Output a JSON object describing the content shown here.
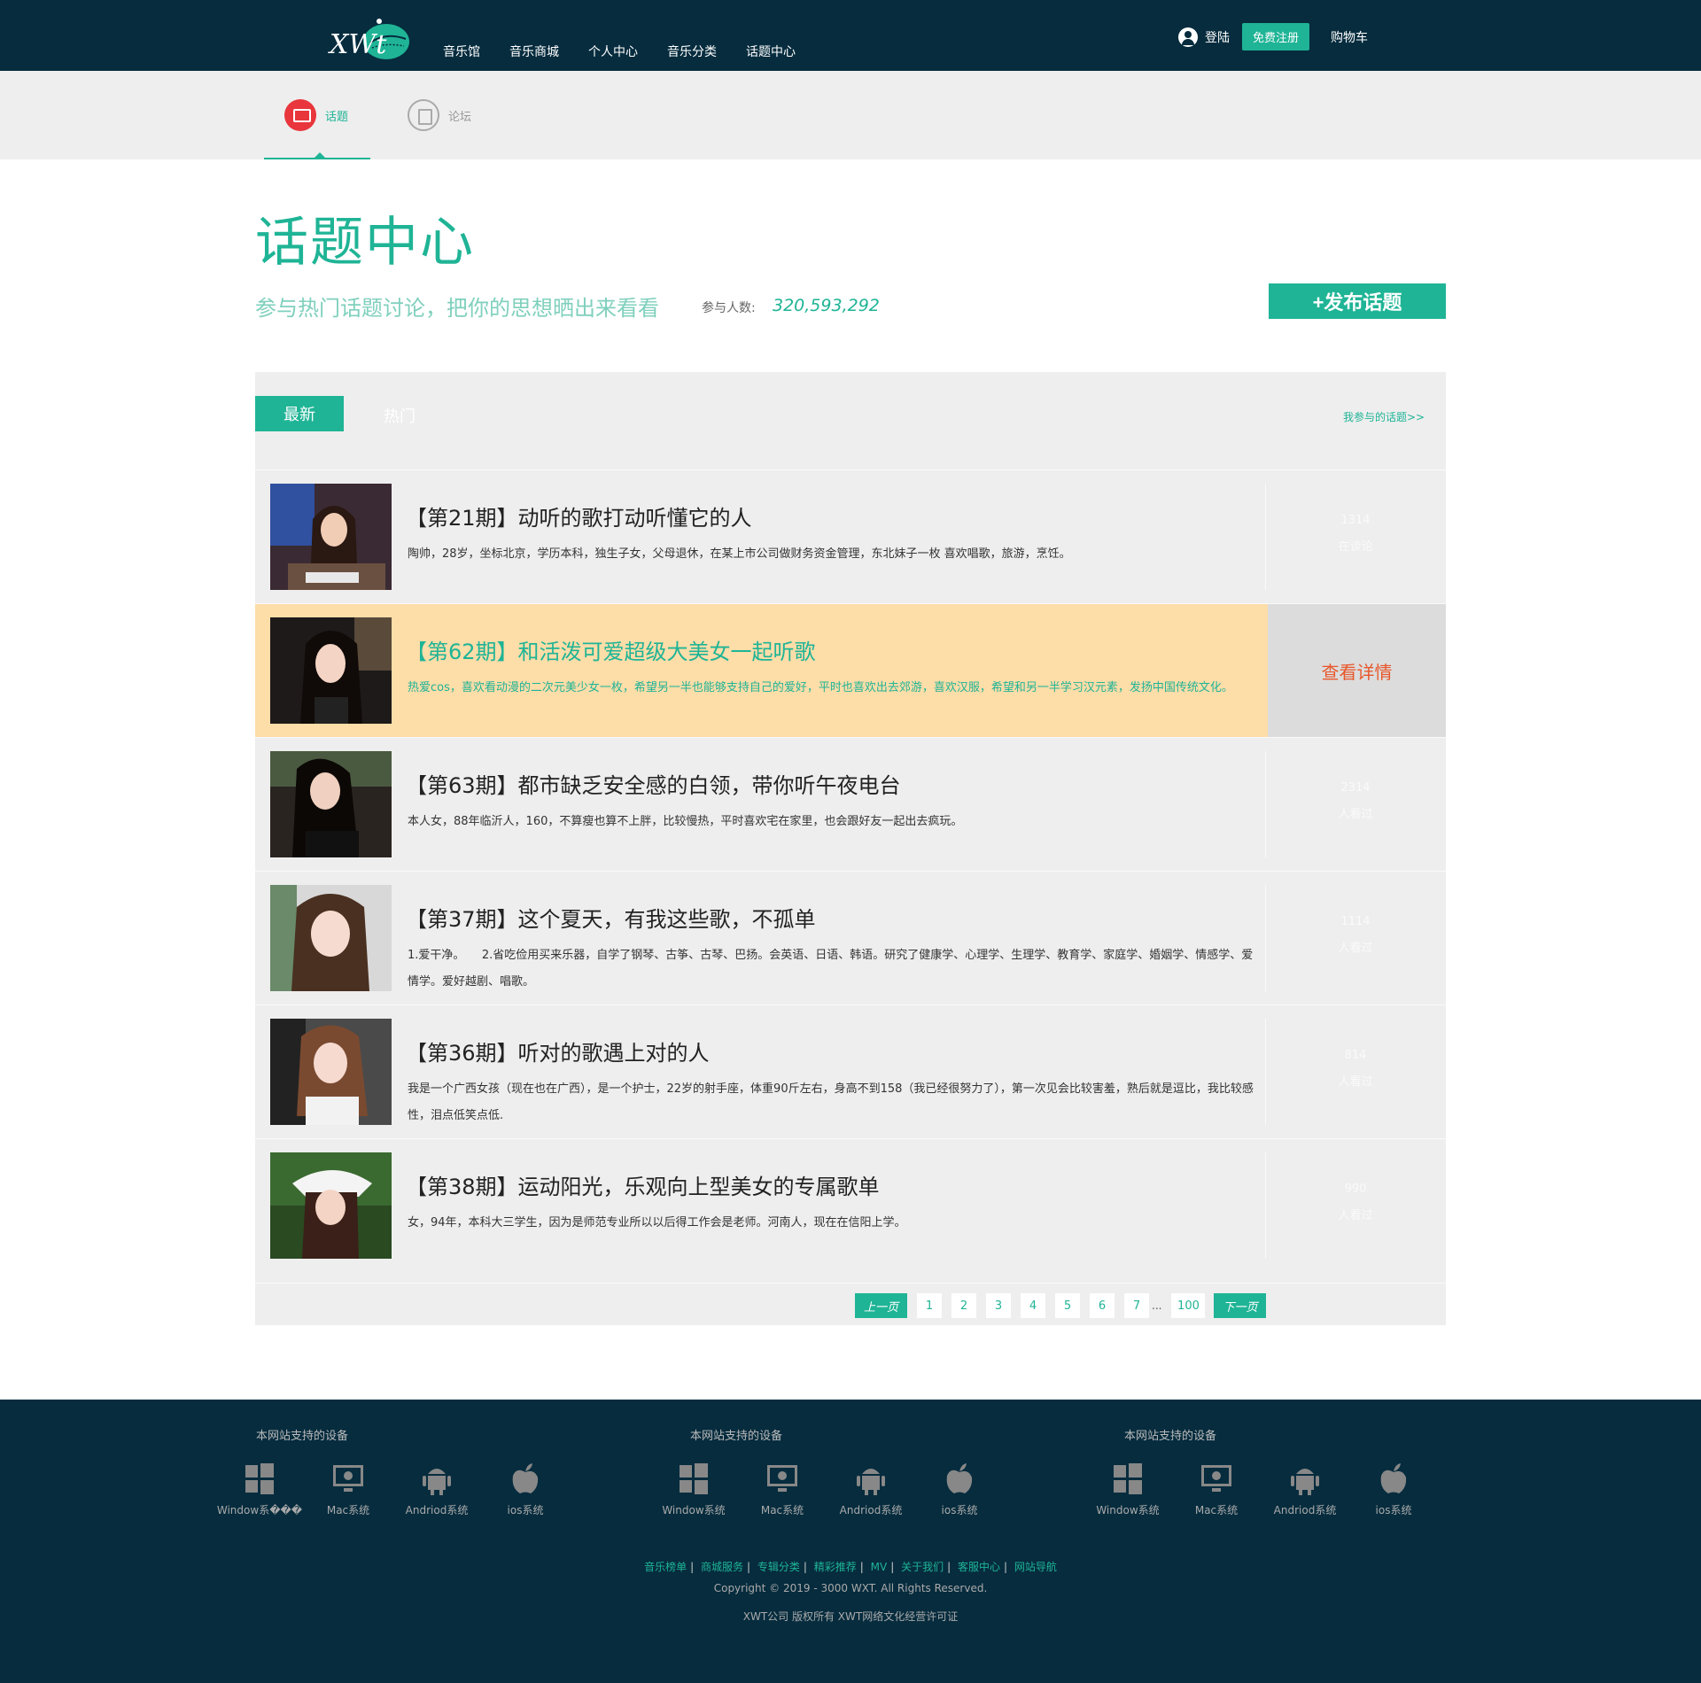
{
  "header": {
    "nav": [
      "音乐馆",
      "音乐商城",
      "个人中心",
      "音乐分类",
      "话题中心"
    ],
    "login": "登陆",
    "register": "免费注册",
    "cart": "购物车"
  },
  "subnav": {
    "topic": "话题",
    "forum": "论坛"
  },
  "hero": {
    "title": "话题中心",
    "slogan": "参与热门话题讨论，把你的思想晒出来看看",
    "participants_label": "参与人数:",
    "participants_count": "320,593,292",
    "publish": "+发布话题"
  },
  "tabs": {
    "latest": "最新",
    "hot": "热门",
    "my_topics": "我参与的话题>>"
  },
  "topics": [
    {
      "title": "【第21期】动听的歌打动听懂它的人",
      "desc": "陶帅，28岁，坐标北京，学历本科，独生子女，父母退休，在某上市公司做财务资金管理，东北妹子一枚 喜欢唱歌，旅游，烹饪。",
      "count": "1314",
      "count_label": "在谈论"
    },
    {
      "title": "【第62期】和活泼可爱超级大美女一起听歌",
      "desc": "热爱cos，喜欢看动漫的二次元美少女一枚，希望另一半也能够支持自己的爱好，平时也喜欢出去郊游，喜欢汉服，希望和另一半学习汉元素，发扬中国传统文化。",
      "detail": "查看详情"
    },
    {
      "title": "【第63期】都市缺乏安全感的白领，带你听午夜电台",
      "desc": "本人女，88年临沂人，160，不算瘦也算不上胖，比较慢热，平时喜欢宅在家里，也会跟好友一起出去疯玩。",
      "count": "2314",
      "count_label": "人看过"
    },
    {
      "title": "【第37期】这个夏天，有我这些歌，不孤单",
      "desc": "1.爱干净。　　2.省吃俭用买来乐器，自学了钢琴、古筝、古琴、巴扬。会英语、日语、韩语。研究了健康学、心理学、生理学、教育学、家庭学、婚姻学、情感学、爱情学。爱好越剧、唱歌。",
      "count": "1114",
      "count_label": "人看过"
    },
    {
      "title": "【第36期】听对的歌遇上对的人",
      "desc": "我是一个广西女孩（现在也在广西），是一个护士，22岁的射手座，体重90斤左右，身高不到158（我已经很努力了），第一次见会比较害羞，熟后就是逗比，我比较感性，泪点低笑点低.",
      "count": "814",
      "count_label": "人看过"
    },
    {
      "title": "【第38期】运动阳光，乐观向上型美女的专属歌单",
      "desc": "女，94年，本科大三学生，因为是师范专业所以以后得工作会是老师。河南人，现在在信阳上学。",
      "count": "990",
      "count_label": "人看过"
    }
  ],
  "pager": {
    "prev": "上一页",
    "pages": [
      "1",
      "2",
      "3",
      "4",
      "5",
      "6",
      "7"
    ],
    "dots": "...",
    "last": "100",
    "next": "下一页"
  },
  "footer": {
    "device_title": "本网站支持的设备",
    "groups": [
      [
        "Window系���",
        "Mac系统",
        "Andriod系统",
        "ios系统"
      ],
      [
        "Window系统",
        "Mac系统",
        "Andriod系统",
        "ios系统"
      ],
      [
        "Window系统",
        "Mac系统",
        "Andriod系统",
        "ios系统"
      ]
    ],
    "links": [
      "音乐榜单",
      "商城服务",
      "专辑分类",
      "精彩推荐",
      "MV",
      "关于我们",
      "客服中心",
      "网站导航"
    ],
    "copyright": "Copyright © 2019 - 3000 WXT. All Rights Reserved.",
    "license": "XWT公司 版权所有 XWT网络文化经营许可证"
  },
  "colors": {
    "header_bg": "#062c3e",
    "accent": "#1fb496",
    "highlight_row": "#fddda8",
    "detail_text": "#e8572b"
  }
}
